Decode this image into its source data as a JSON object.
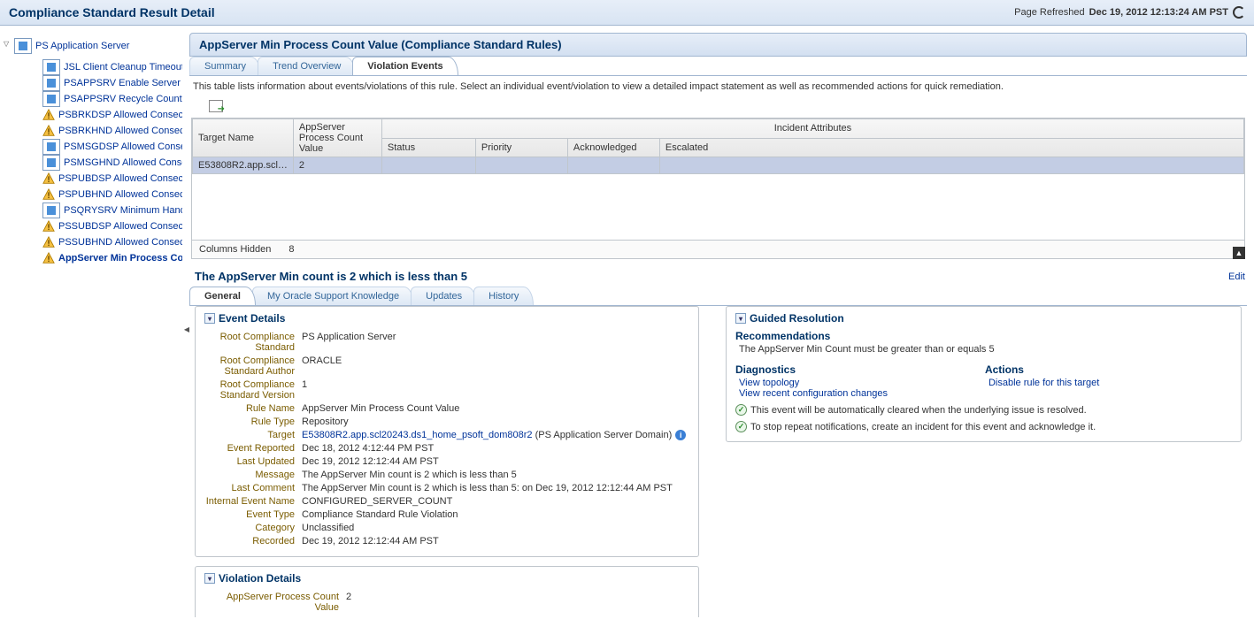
{
  "header": {
    "title": "Compliance Standard Result Detail",
    "refreshed_label": "Page Refreshed",
    "refreshed_time": "Dec 19, 2012 12:13:24 AM PST"
  },
  "sidebar": {
    "root": "PS Application Server",
    "items": [
      {
        "icon": "doc",
        "label": "JSL Client Cleanup Timeout"
      },
      {
        "icon": "doc",
        "label": "PSAPPSRV Enable Server C"
      },
      {
        "icon": "doc",
        "label": "PSAPPSRV Recycle Count"
      },
      {
        "icon": "warn",
        "label": "PSBRKDSP Allowed Consecutiv"
      },
      {
        "icon": "warn",
        "label": "PSBRKHND Allowed Consecutiv"
      },
      {
        "icon": "doc",
        "label": "PSMSGDSP Allowed Consec"
      },
      {
        "icon": "doc",
        "label": "PSMSGHND Allowed Conse"
      },
      {
        "icon": "warn",
        "label": "PSPUBDSP Allowed Consecutiv"
      },
      {
        "icon": "warn",
        "label": "PSPUBHND Allowed Consecutiv"
      },
      {
        "icon": "doc",
        "label": "PSQRYSRV Minimum Handle"
      },
      {
        "icon": "warn",
        "label": "PSSUBDSP Allowed Consecutiv"
      },
      {
        "icon": "warn",
        "label": "PSSUBHND Allowed Consecutiv"
      },
      {
        "icon": "warn",
        "label": "AppServer Min Process Co",
        "bold": true
      }
    ]
  },
  "content": {
    "title": "AppServer Min Process Count Value (Compliance Standard Rules)",
    "tabs_top": [
      "Summary",
      "Trend Overview",
      "Violation Events"
    ],
    "active_top_tab": 2,
    "description": "This table lists information about events/violations of this rule. Select an individual event/violation to view a detailed impact statement as well as recommended actions for quick remediation.",
    "grid": {
      "group_header": "Incident Attributes",
      "columns": [
        "Target Name",
        "AppServer Process Count Value",
        "Status",
        "Priority",
        "Acknowledged",
        "Escalated"
      ],
      "rows": [
        {
          "target": "E53808R2.app.scl…",
          "value": "2",
          "status": "",
          "priority": "",
          "ack": "",
          "esc": ""
        }
      ],
      "footer_label": "Columns Hidden",
      "footer_value": "8"
    },
    "event_title": "The AppServer Min count is 2 which is less than 5",
    "edit_link": "Edit",
    "tabs_bottom": [
      "General",
      "My Oracle Support Knowledge",
      "Updates",
      "History"
    ],
    "active_bottom_tab": 0,
    "event_details_title": "Event Details",
    "event_details": [
      {
        "label": "Root Compliance Standard",
        "value": "PS Application Server"
      },
      {
        "label": "Root Compliance Standard Author",
        "value": "ORACLE"
      },
      {
        "label": "Root Compliance Standard Version",
        "value": "1"
      },
      {
        "label": "Rule Name",
        "value": "AppServer Min Process Count Value"
      },
      {
        "label": "Rule Type",
        "value": "Repository"
      },
      {
        "label": "Target",
        "value": "E53808R2.app.scl20243.ds1_home_psoft_dom808r2",
        "suffix": " (PS Application Server Domain)",
        "link": true,
        "info": true
      },
      {
        "label": "Event Reported",
        "value": "Dec 18, 2012 4:12:44 PM PST"
      },
      {
        "label": "Last Updated",
        "value": "Dec 19, 2012 12:12:44 AM PST"
      },
      {
        "label": "Message",
        "value": "The AppServer Min count is 2 which is less than 5"
      },
      {
        "label": "Last Comment",
        "value": "The AppServer Min count is 2 which is less than 5: on Dec 19, 2012 12:12:44 AM PST"
      },
      {
        "label": "Internal Event Name",
        "value": "CONFIGURED_SERVER_COUNT"
      },
      {
        "label": "Event Type",
        "value": "Compliance Standard Rule Violation"
      },
      {
        "label": "Category",
        "value": "Unclassified"
      },
      {
        "label": "Recorded",
        "value": "Dec 19, 2012 12:12:44 AM PST"
      }
    ],
    "violation_details_title": "Violation Details",
    "violation_details": [
      {
        "label": "AppServer Process Count Value",
        "value": "2"
      }
    ],
    "guided_title": "Guided Resolution",
    "guided": {
      "rec_heading": "Recommendations",
      "rec_text": "The AppServer Min Count must be greater than or equals 5",
      "diag_heading": "Diagnostics",
      "diag_links": [
        "View topology",
        "View recent configuration changes"
      ],
      "actions_heading": "Actions",
      "actions_links": [
        "Disable rule for this target"
      ],
      "notes": [
        "This event will be automatically cleared when the underlying issue is resolved.",
        "To stop repeat notifications, create an incident for this event and acknowledge it."
      ]
    }
  }
}
